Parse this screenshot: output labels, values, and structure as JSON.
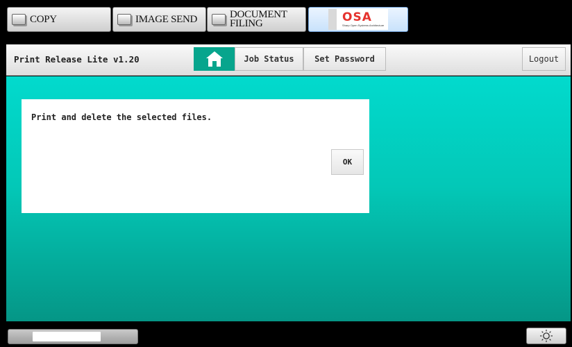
{
  "mode_tabs": [
    {
      "label": "COPY",
      "icon": "copy-icon"
    },
    {
      "label": "IMAGE SEND",
      "icon": "image-send-icon"
    },
    {
      "label_line1": "DOCUMENT",
      "label_line2": "FILING",
      "icon": "document-filing-icon"
    },
    {
      "logo_text": "OSA",
      "logo_sub": "Sharp Open Systems Architecture",
      "icon": "osa-logo"
    }
  ],
  "app": {
    "title": "Print Release Lite  v1.20",
    "nav": {
      "home_icon": "home-icon",
      "job_status": "Job Status",
      "set_password": "Set Password",
      "logout": "Logout"
    }
  },
  "dialog": {
    "message": "Print and delete the selected files.",
    "ok_label": "OK"
  },
  "status_bar": {
    "progress_fraction": 0.65,
    "brightness_icon": "sun-icon"
  },
  "colors": {
    "accent": "#07a58d",
    "panel_top": "#02dacd",
    "panel_bottom": "#059686",
    "osa_red": "#e5322d"
  }
}
